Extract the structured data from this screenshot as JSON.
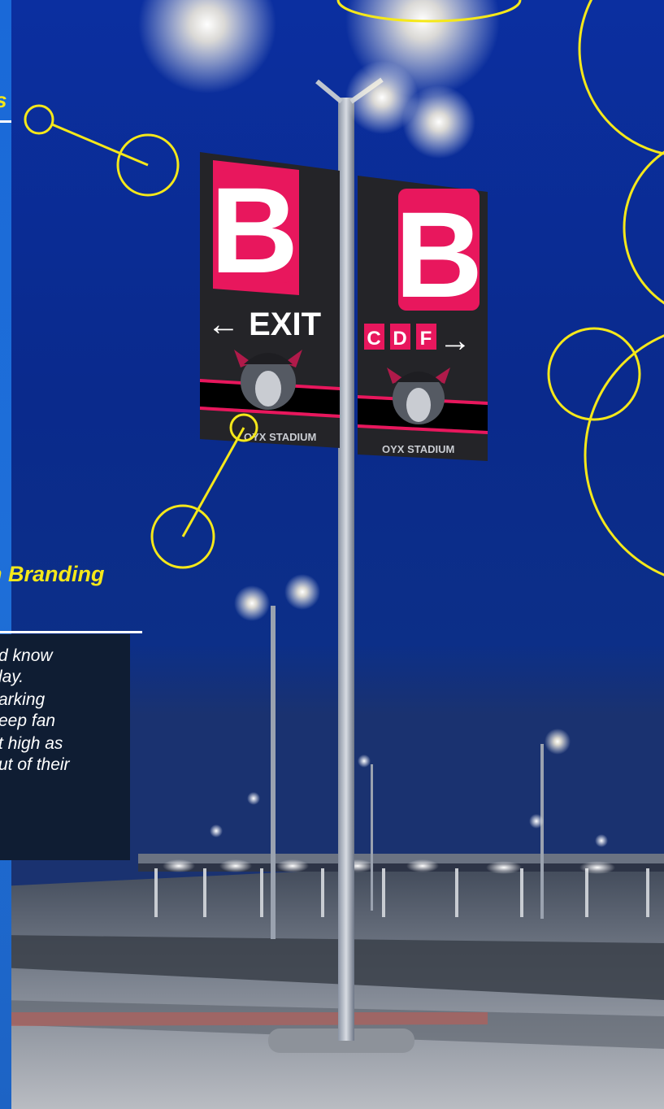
{
  "texts": {
    "heading_top_partial": "s",
    "heading_main_partial": "n Branding",
    "body_lines": [
      "d know",
      "lay.",
      "arking",
      "eep fan",
      "t high as",
      "ut of their"
    ]
  },
  "signs": {
    "left": {
      "letter": "B",
      "direction_text": "EXIT",
      "arrow": "left-arrow",
      "footer": "OYX STADIUM"
    },
    "right": {
      "letter": "B",
      "zones": [
        "C",
        "D",
        "F"
      ],
      "arrow": "right-arrow",
      "footer": "OYX STADIUM"
    }
  },
  "colors": {
    "sky": "#0b2a8f",
    "accent_yellow": "#f5e81a",
    "sign_panel": "#2a2a2e",
    "sign_letter_bg": "#e8175d",
    "panel_dark": "#0f1d33"
  }
}
